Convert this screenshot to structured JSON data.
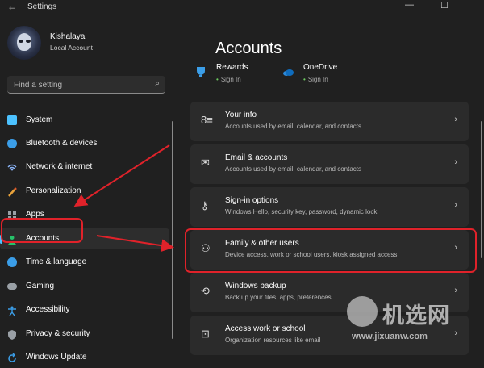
{
  "window": {
    "back": "←",
    "title": "Settings",
    "min": "—",
    "max": "☐"
  },
  "user": {
    "name": "Kishalaya",
    "account": "Local Account"
  },
  "search": {
    "placeholder": "Find a setting",
    "icon": "⌕"
  },
  "nav": [
    {
      "label": "System",
      "icon": "monitor-icon",
      "color": "#4cc2ff"
    },
    {
      "label": "Bluetooth & devices",
      "icon": "bluetooth-icon",
      "color": "#3b9ee8"
    },
    {
      "label": "Network & internet",
      "icon": "wifi-icon",
      "color": "#8ab4f8"
    },
    {
      "label": "Personalization",
      "icon": "brush-icon",
      "color": "#e8a23b"
    },
    {
      "label": "Apps",
      "icon": "apps-icon",
      "color": "#9aa0a6"
    },
    {
      "label": "Accounts",
      "icon": "person-icon",
      "color": "#27c26a",
      "active": true
    },
    {
      "label": "Time & language",
      "icon": "globe-clock-icon",
      "color": "#3b9ee8"
    },
    {
      "label": "Gaming",
      "icon": "gamepad-icon",
      "color": "#9aa0a6"
    },
    {
      "label": "Accessibility",
      "icon": "accessibility-icon",
      "color": "#3b9ee8"
    },
    {
      "label": "Privacy & security",
      "icon": "shield-icon",
      "color": "#9aa0a6"
    },
    {
      "label": "Windows Update",
      "icon": "update-icon",
      "color": "#3b9ee8"
    }
  ],
  "main": {
    "title": "Accounts",
    "services": [
      {
        "name": "Rewards",
        "status": "Sign In",
        "icon": "rewards-icon"
      },
      {
        "name": "OneDrive",
        "status": "Sign In",
        "icon": "onedrive-icon"
      }
    ],
    "cards": [
      {
        "title": "Your info",
        "subtitle": "Accounts used by email, calendar, and contacts",
        "icon": "person-card-icon",
        "glyph": "8≡"
      },
      {
        "title": "Email & accounts",
        "subtitle": "Accounts used by email, calendar, and contacts",
        "icon": "envelope-icon",
        "glyph": "✉"
      },
      {
        "title": "Sign-in options",
        "subtitle": "Windows Hello, security key, password, dynamic lock",
        "icon": "key-icon",
        "glyph": "⚷"
      },
      {
        "title": "Family & other users",
        "subtitle": "Device access, work or school users, kiosk assigned access",
        "icon": "family-users-icon",
        "glyph": "⚇"
      },
      {
        "title": "Windows backup",
        "subtitle": "Back up your files, apps, preferences",
        "icon": "backup-icon",
        "glyph": "⟲"
      },
      {
        "title": "Access work or school",
        "subtitle": "Organization resources like email",
        "icon": "briefcase-icon",
        "glyph": "⊡"
      }
    ],
    "chevron": "›"
  },
  "watermark": {
    "text": "机选网",
    "url": "www.jixuanw.com"
  },
  "colors": {
    "highlight": "#e0222a",
    "accent": "#4cc2ff"
  }
}
